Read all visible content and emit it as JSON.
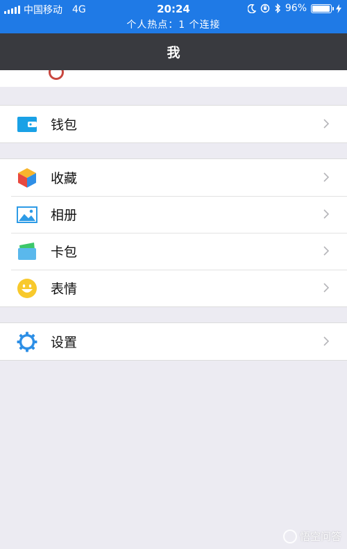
{
  "status_bar": {
    "carrier": "中国移动",
    "network": "4G",
    "time": "20:24",
    "battery_percent": "96%",
    "battery_level": 0.96,
    "hotspot_text": "个人热点：1 个连接",
    "bg_color": "#1f7ae6"
  },
  "navbar": {
    "title": "我",
    "bg_color": "#393a3f"
  },
  "groups": [
    {
      "items": [
        {
          "label": "钱包",
          "icon": "wallet-icon"
        }
      ]
    },
    {
      "items": [
        {
          "label": "收藏",
          "icon": "favorites-cube-icon"
        },
        {
          "label": "相册",
          "icon": "album-picture-icon"
        },
        {
          "label": "卡包",
          "icon": "card-pack-icon"
        },
        {
          "label": "表情",
          "icon": "emoji-smile-icon"
        }
      ]
    },
    {
      "items": [
        {
          "label": "设置",
          "icon": "settings-gear-icon"
        }
      ]
    }
  ],
  "watermark": {
    "text": "悟空问答",
    "icon": "wukong-logo-icon"
  }
}
